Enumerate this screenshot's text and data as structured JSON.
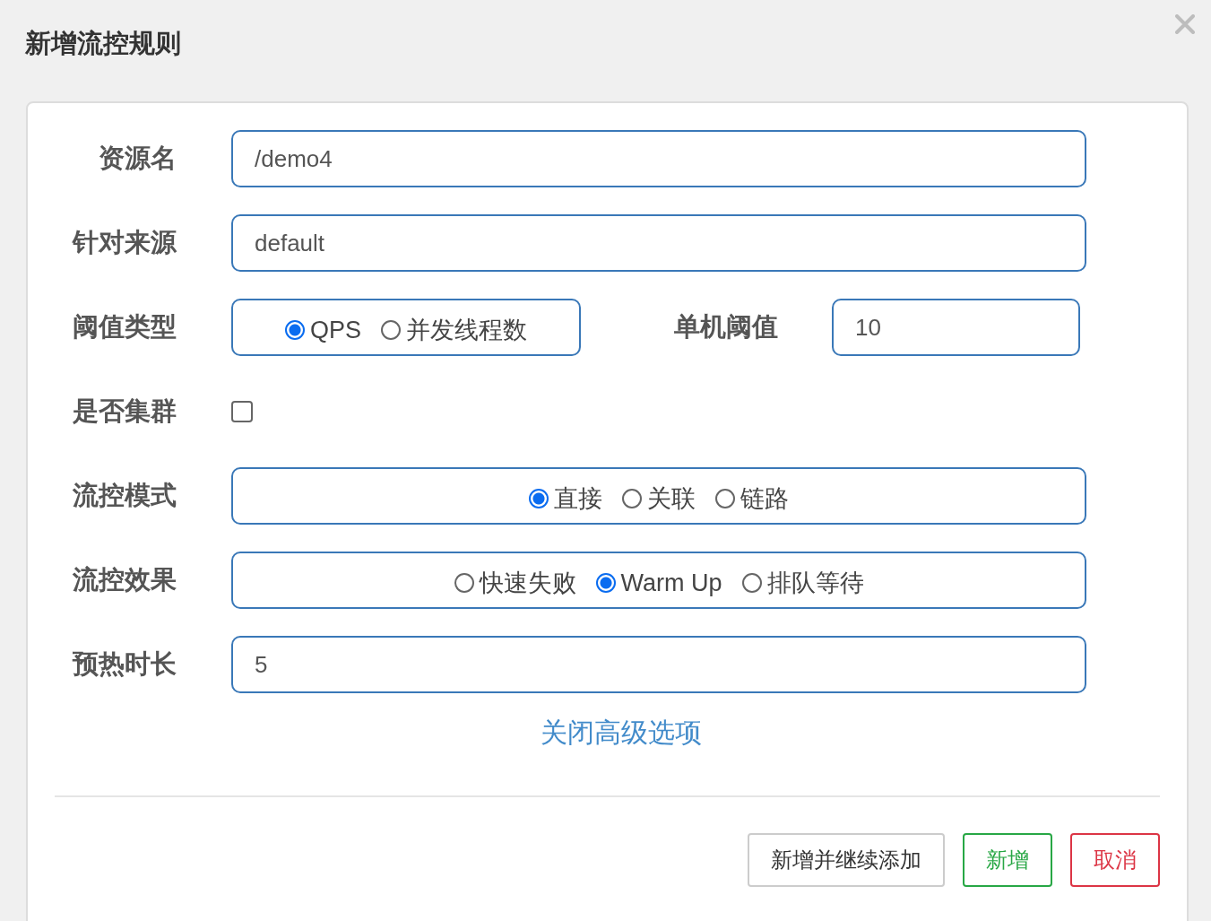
{
  "dialog": {
    "title": "新增流控规则"
  },
  "rows": [
    {
      "kind": "text",
      "label": "资源名",
      "value": "/demo4"
    },
    {
      "kind": "text",
      "label": "针对来源",
      "value": "default"
    },
    {
      "kind": "radio_field",
      "label": "阈值类型",
      "options": [
        {
          "label": "QPS",
          "selected": true
        },
        {
          "label": "并发线程数",
          "selected": false
        }
      ],
      "field_label": "单机阈值",
      "value": "10"
    },
    {
      "kind": "checkbox",
      "label": "是否集群",
      "checked": false
    },
    {
      "kind": "radio",
      "label": "流控模式",
      "options": [
        {
          "label": "直接",
          "selected": true
        },
        {
          "label": "关联",
          "selected": false
        },
        {
          "label": "链路",
          "selected": false
        }
      ]
    },
    {
      "kind": "radio",
      "label": "流控效果",
      "options": [
        {
          "label": "快速失败",
          "selected": false
        },
        {
          "label": "Warm Up",
          "selected": true
        },
        {
          "label": "排队等待",
          "selected": false
        }
      ]
    },
    {
      "kind": "text",
      "label": "预热时长",
      "value": "5"
    }
  ],
  "advanced_link": "关闭高级选项",
  "buttons": [
    {
      "label": "新增并继续添加",
      "kind": "default"
    },
    {
      "label": "新增",
      "kind": "success"
    },
    {
      "label": "取消",
      "kind": "danger"
    }
  ]
}
